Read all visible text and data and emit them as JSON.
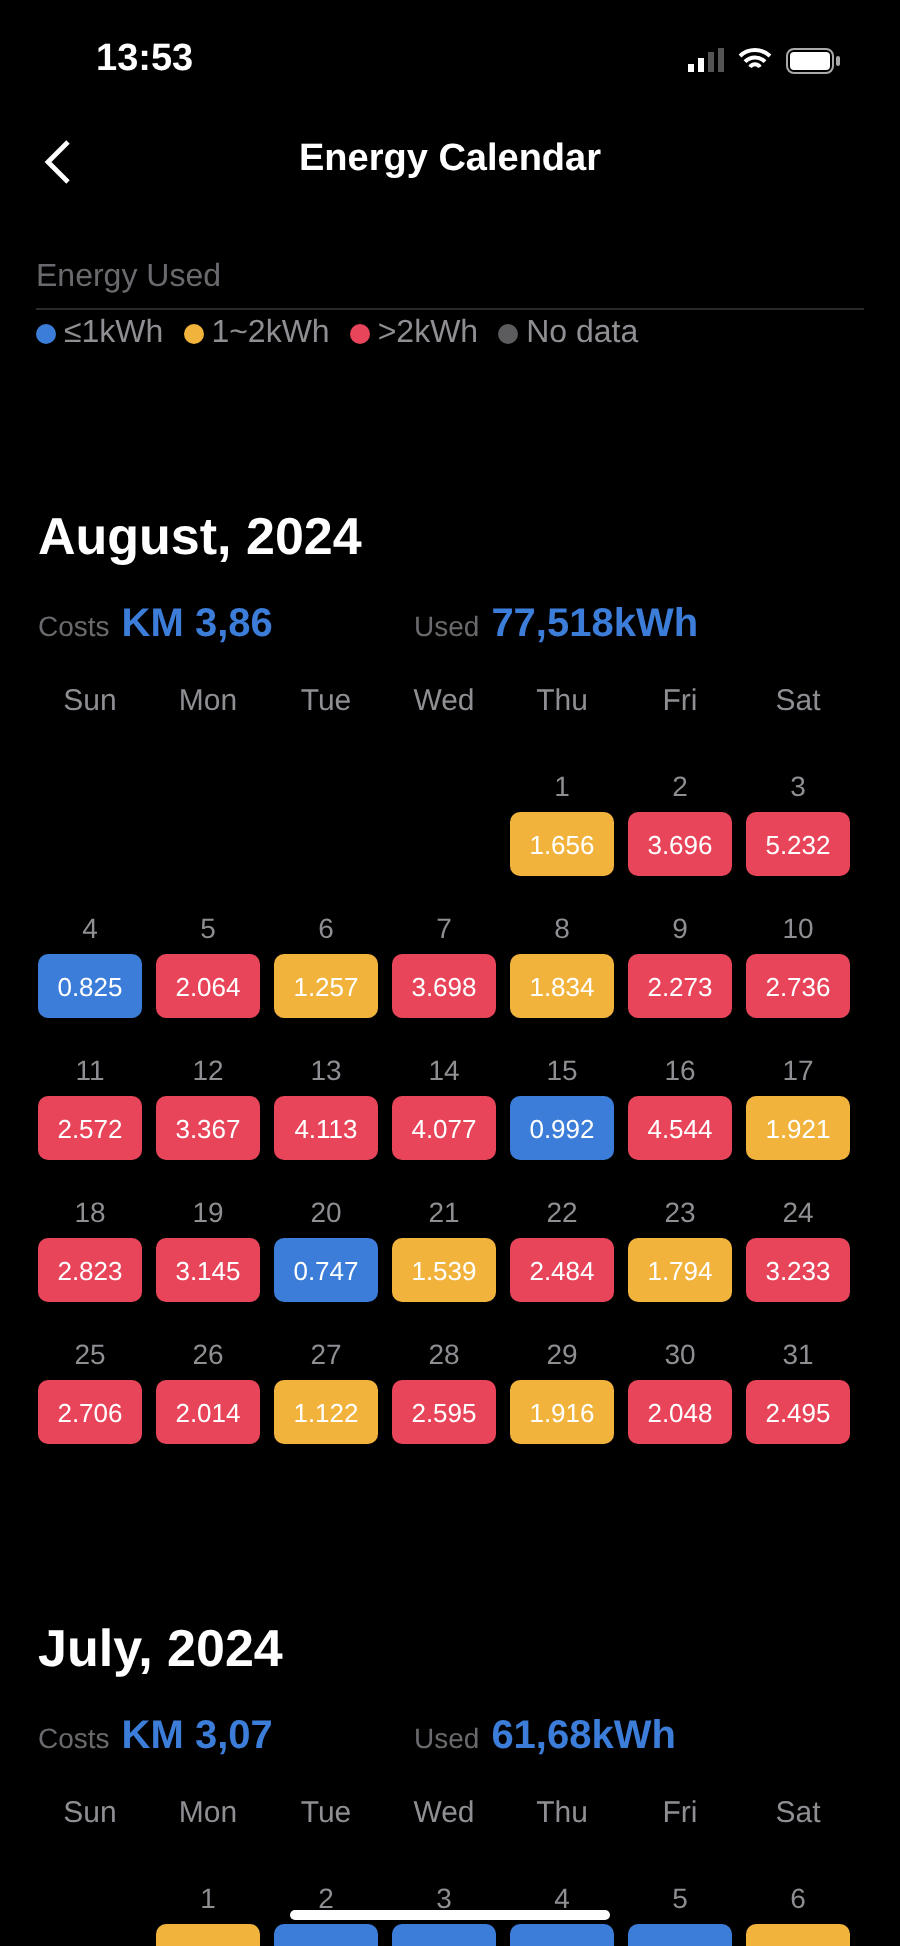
{
  "status_bar": {
    "time": "13:53"
  },
  "nav": {
    "title": "Energy Calendar"
  },
  "legend": {
    "title": "Energy Used",
    "items": [
      {
        "label": "≤1kWh",
        "color": "#3b7dd8"
      },
      {
        "label": "1~2kWh",
        "color": "#f2b33d"
      },
      {
        "label": ">2kWh",
        "color": "#e8455a"
      },
      {
        "label": "No data",
        "color": "#5c5c5e"
      }
    ]
  },
  "months": [
    {
      "title": "August, 2024",
      "costs_label": "Costs",
      "costs": "KM 3,86",
      "used_label": "Used",
      "used": "77,518kWh",
      "weekdays": [
        "Sun",
        "Mon",
        "Tue",
        "Wed",
        "Thu",
        "Fri",
        "Sat"
      ],
      "weeks": [
        [
          {
            "kind": "blank"
          },
          {
            "kind": "blank"
          },
          {
            "kind": "blank"
          },
          {
            "kind": "blank"
          },
          {
            "kind": "day",
            "day": "1",
            "value": "1.656",
            "color": "#f2b33d"
          },
          {
            "kind": "day",
            "day": "2",
            "value": "3.696",
            "color": "#e8455a"
          },
          {
            "kind": "day",
            "day": "3",
            "value": "5.232",
            "color": "#e8455a"
          }
        ],
        [
          {
            "kind": "day",
            "day": "4",
            "value": "0.825",
            "color": "#3b7dd8"
          },
          {
            "kind": "day",
            "day": "5",
            "value": "2.064",
            "color": "#e8455a"
          },
          {
            "kind": "day",
            "day": "6",
            "value": "1.257",
            "color": "#f2b33d"
          },
          {
            "kind": "day",
            "day": "7",
            "value": "3.698",
            "color": "#e8455a"
          },
          {
            "kind": "day",
            "day": "8",
            "value": "1.834",
            "color": "#f2b33d"
          },
          {
            "kind": "day",
            "day": "9",
            "value": "2.273",
            "color": "#e8455a"
          },
          {
            "kind": "day",
            "day": "10",
            "value": "2.736",
            "color": "#e8455a"
          }
        ],
        [
          {
            "kind": "day",
            "day": "11",
            "value": "2.572",
            "color": "#e8455a"
          },
          {
            "kind": "day",
            "day": "12",
            "value": "3.367",
            "color": "#e8455a"
          },
          {
            "kind": "day",
            "day": "13",
            "value": "4.113",
            "color": "#e8455a"
          },
          {
            "kind": "day",
            "day": "14",
            "value": "4.077",
            "color": "#e8455a"
          },
          {
            "kind": "day",
            "day": "15",
            "value": "0.992",
            "color": "#3b7dd8"
          },
          {
            "kind": "day",
            "day": "16",
            "value": "4.544",
            "color": "#e8455a"
          },
          {
            "kind": "day",
            "day": "17",
            "value": "1.921",
            "color": "#f2b33d"
          }
        ],
        [
          {
            "kind": "day",
            "day": "18",
            "value": "2.823",
            "color": "#e8455a"
          },
          {
            "kind": "day",
            "day": "19",
            "value": "3.145",
            "color": "#e8455a"
          },
          {
            "kind": "day",
            "day": "20",
            "value": "0.747",
            "color": "#3b7dd8"
          },
          {
            "kind": "day",
            "day": "21",
            "value": "1.539",
            "color": "#f2b33d"
          },
          {
            "kind": "day",
            "day": "22",
            "value": "2.484",
            "color": "#e8455a"
          },
          {
            "kind": "day",
            "day": "23",
            "value": "1.794",
            "color": "#f2b33d"
          },
          {
            "kind": "day",
            "day": "24",
            "value": "3.233",
            "color": "#e8455a"
          }
        ],
        [
          {
            "kind": "day",
            "day": "25",
            "value": "2.706",
            "color": "#e8455a"
          },
          {
            "kind": "day",
            "day": "26",
            "value": "2.014",
            "color": "#e8455a"
          },
          {
            "kind": "day",
            "day": "27",
            "value": "1.122",
            "color": "#f2b33d"
          },
          {
            "kind": "day",
            "day": "28",
            "value": "2.595",
            "color": "#e8455a"
          },
          {
            "kind": "day",
            "day": "29",
            "value": "1.916",
            "color": "#f2b33d"
          },
          {
            "kind": "day",
            "day": "30",
            "value": "2.048",
            "color": "#e8455a"
          },
          {
            "kind": "day",
            "day": "31",
            "value": "2.495",
            "color": "#e8455a"
          }
        ]
      ]
    },
    {
      "title": "July, 2024",
      "costs_label": "Costs",
      "costs": "KM 3,07",
      "used_label": "Used",
      "used": "61,68kWh",
      "weekdays": [
        "Sun",
        "Mon",
        "Tue",
        "Wed",
        "Thu",
        "Fri",
        "Sat"
      ],
      "weeks": [
        [
          {
            "kind": "blank"
          },
          {
            "kind": "day",
            "day": "1",
            "color": "#f2b33d"
          },
          {
            "kind": "day",
            "day": "2",
            "color": "#3b7dd8"
          },
          {
            "kind": "day",
            "day": "3",
            "color": "#3b7dd8"
          },
          {
            "kind": "day",
            "day": "4",
            "color": "#3b7dd8"
          },
          {
            "kind": "day",
            "day": "5",
            "color": "#3b7dd8"
          },
          {
            "kind": "day",
            "day": "6",
            "color": "#f2b33d"
          }
        ]
      ]
    }
  ]
}
